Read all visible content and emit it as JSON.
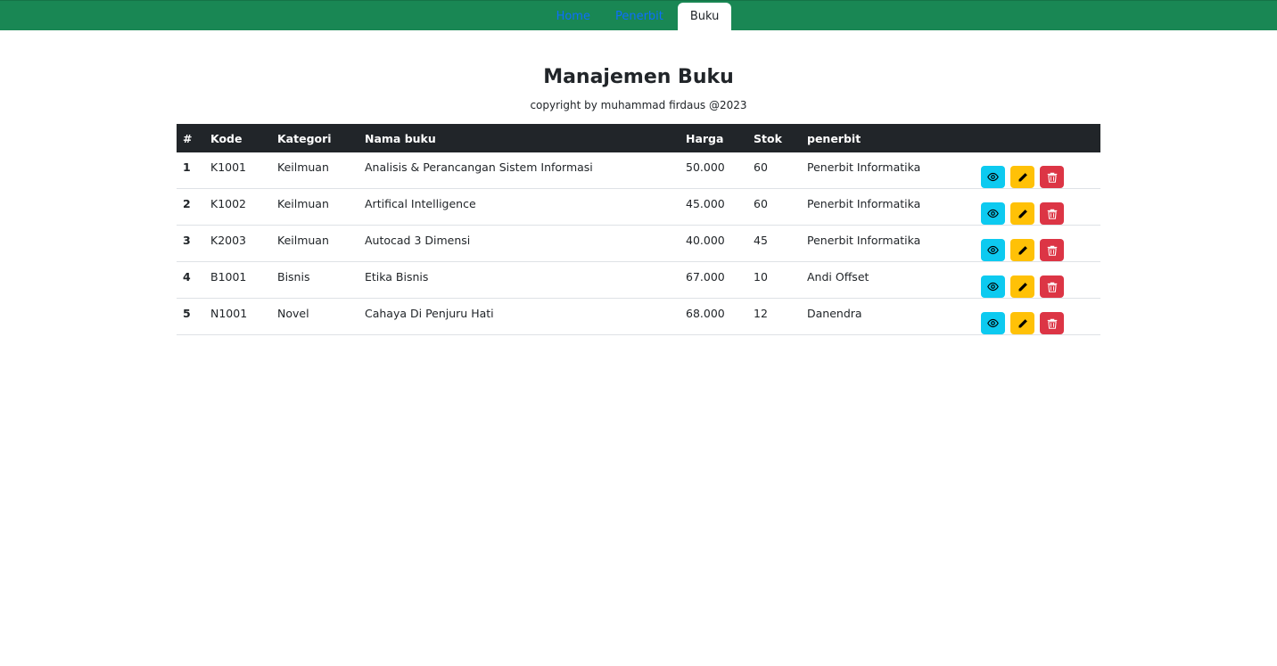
{
  "nav": {
    "tabs": [
      {
        "label": "Home",
        "active": false
      },
      {
        "label": "Penerbit",
        "active": false
      },
      {
        "label": "Buku",
        "active": true
      }
    ]
  },
  "page": {
    "title": "Manajemen Buku",
    "subtitle": "copyright by muhammad firdaus @2023"
  },
  "table": {
    "headers": [
      "#",
      "Kode",
      "Kategori",
      "Nama buku",
      "Harga",
      "Stok",
      "penerbit",
      ""
    ],
    "rows": [
      {
        "no": "1",
        "kode": "K1001",
        "kategori": "Keilmuan",
        "nama": "Analisis & Perancangan Sistem Informasi",
        "harga": "50.000",
        "stok": "60",
        "penerbit": "Penerbit Informatika"
      },
      {
        "no": "2",
        "kode": "K1002",
        "kategori": "Keilmuan",
        "nama": "Artifical Intelligence",
        "harga": "45.000",
        "stok": "60",
        "penerbit": "Penerbit Informatika"
      },
      {
        "no": "3",
        "kode": "K2003",
        "kategori": "Keilmuan",
        "nama": "Autocad 3 Dimensi",
        "harga": "40.000",
        "stok": "45",
        "penerbit": "Penerbit Informatika"
      },
      {
        "no": "4",
        "kode": "B1001",
        "kategori": "Bisnis",
        "nama": "Etika Bisnis",
        "harga": "67.000",
        "stok": "10",
        "penerbit": "Andi Offset"
      },
      {
        "no": "5",
        "kode": "N1001",
        "kategori": "Novel",
        "nama": "Cahaya Di Penjuru Hati",
        "harga": "68.000",
        "stok": "12",
        "penerbit": "Danendra"
      }
    ],
    "row_actions": [
      "eye-icon",
      "pencil-icon",
      "trash-icon"
    ]
  },
  "colors": {
    "navbar": "#198754",
    "link": "#0d6efd",
    "table_header": "#212529",
    "view_button": "#0dcaf0",
    "edit_button": "#ffc107",
    "delete_button": "#dc3545"
  }
}
